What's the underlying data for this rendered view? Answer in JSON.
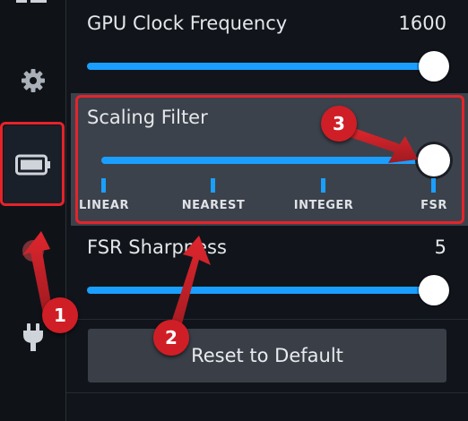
{
  "gpu_clock": {
    "label": "GPU Clock Frequency",
    "value": "1600",
    "level": 1.0
  },
  "scaling_filter": {
    "label": "Scaling Filter",
    "options": [
      "LINEAR",
      "NEAREST",
      "INTEGER",
      "FSR"
    ],
    "selected": "FSR"
  },
  "fsr_sharpness": {
    "label": "FSR Sharpness",
    "value": "5",
    "level": 1.0
  },
  "reset_label": "Reset to Default",
  "sidebar": {
    "icons": [
      "menu-icon",
      "gear-icon",
      "battery-icon",
      "help-icon",
      "plug-icon"
    ],
    "active": "battery-icon"
  },
  "annotations": {
    "badge_1": "1",
    "badge_2": "2",
    "badge_3": "3"
  },
  "colors": {
    "accent": "#1a9fff",
    "highlight": "#e5232b",
    "badge": "#d01e26"
  }
}
